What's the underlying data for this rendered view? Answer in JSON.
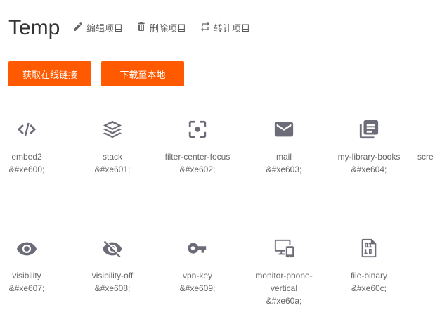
{
  "project": {
    "title": "Temp"
  },
  "actions": {
    "edit": "编辑项目",
    "delete": "删除项目",
    "transfer": "转让项目"
  },
  "buttons": {
    "online_link": "获取在线链接",
    "download_local": "下载至本地"
  },
  "colors": {
    "accent": "#ff5a00",
    "icon": "#6c6c78"
  },
  "icons": [
    {
      "name": "embed2",
      "code": "&#xe600;",
      "icon": "embed2-icon"
    },
    {
      "name": "stack",
      "code": "&#xe601;",
      "icon": "stack-icon"
    },
    {
      "name": "filter-center-focus",
      "code": "&#xe602;",
      "icon": "filter-center-focus-icon"
    },
    {
      "name": "mail",
      "code": "&#xe603;",
      "icon": "mail-icon"
    },
    {
      "name": "my-library-books",
      "code": "&#xe604;",
      "icon": "my-library-books-icon"
    },
    {
      "name": "scre",
      "code": "",
      "icon": ""
    },
    {
      "name": "visibility",
      "code": "&#xe607;",
      "icon": "visibility-icon"
    },
    {
      "name": "visibility-off",
      "code": "&#xe608;",
      "icon": "visibility-off-icon"
    },
    {
      "name": "vpn-key",
      "code": "&#xe609;",
      "icon": "vpn-key-icon"
    },
    {
      "name": "monitor-phone-vertical",
      "code": "&#xe60a;",
      "icon": "monitor-phone-vertical-icon"
    },
    {
      "name": "file-binary",
      "code": "&#xe60c;",
      "icon": "file-binary-icon"
    }
  ]
}
